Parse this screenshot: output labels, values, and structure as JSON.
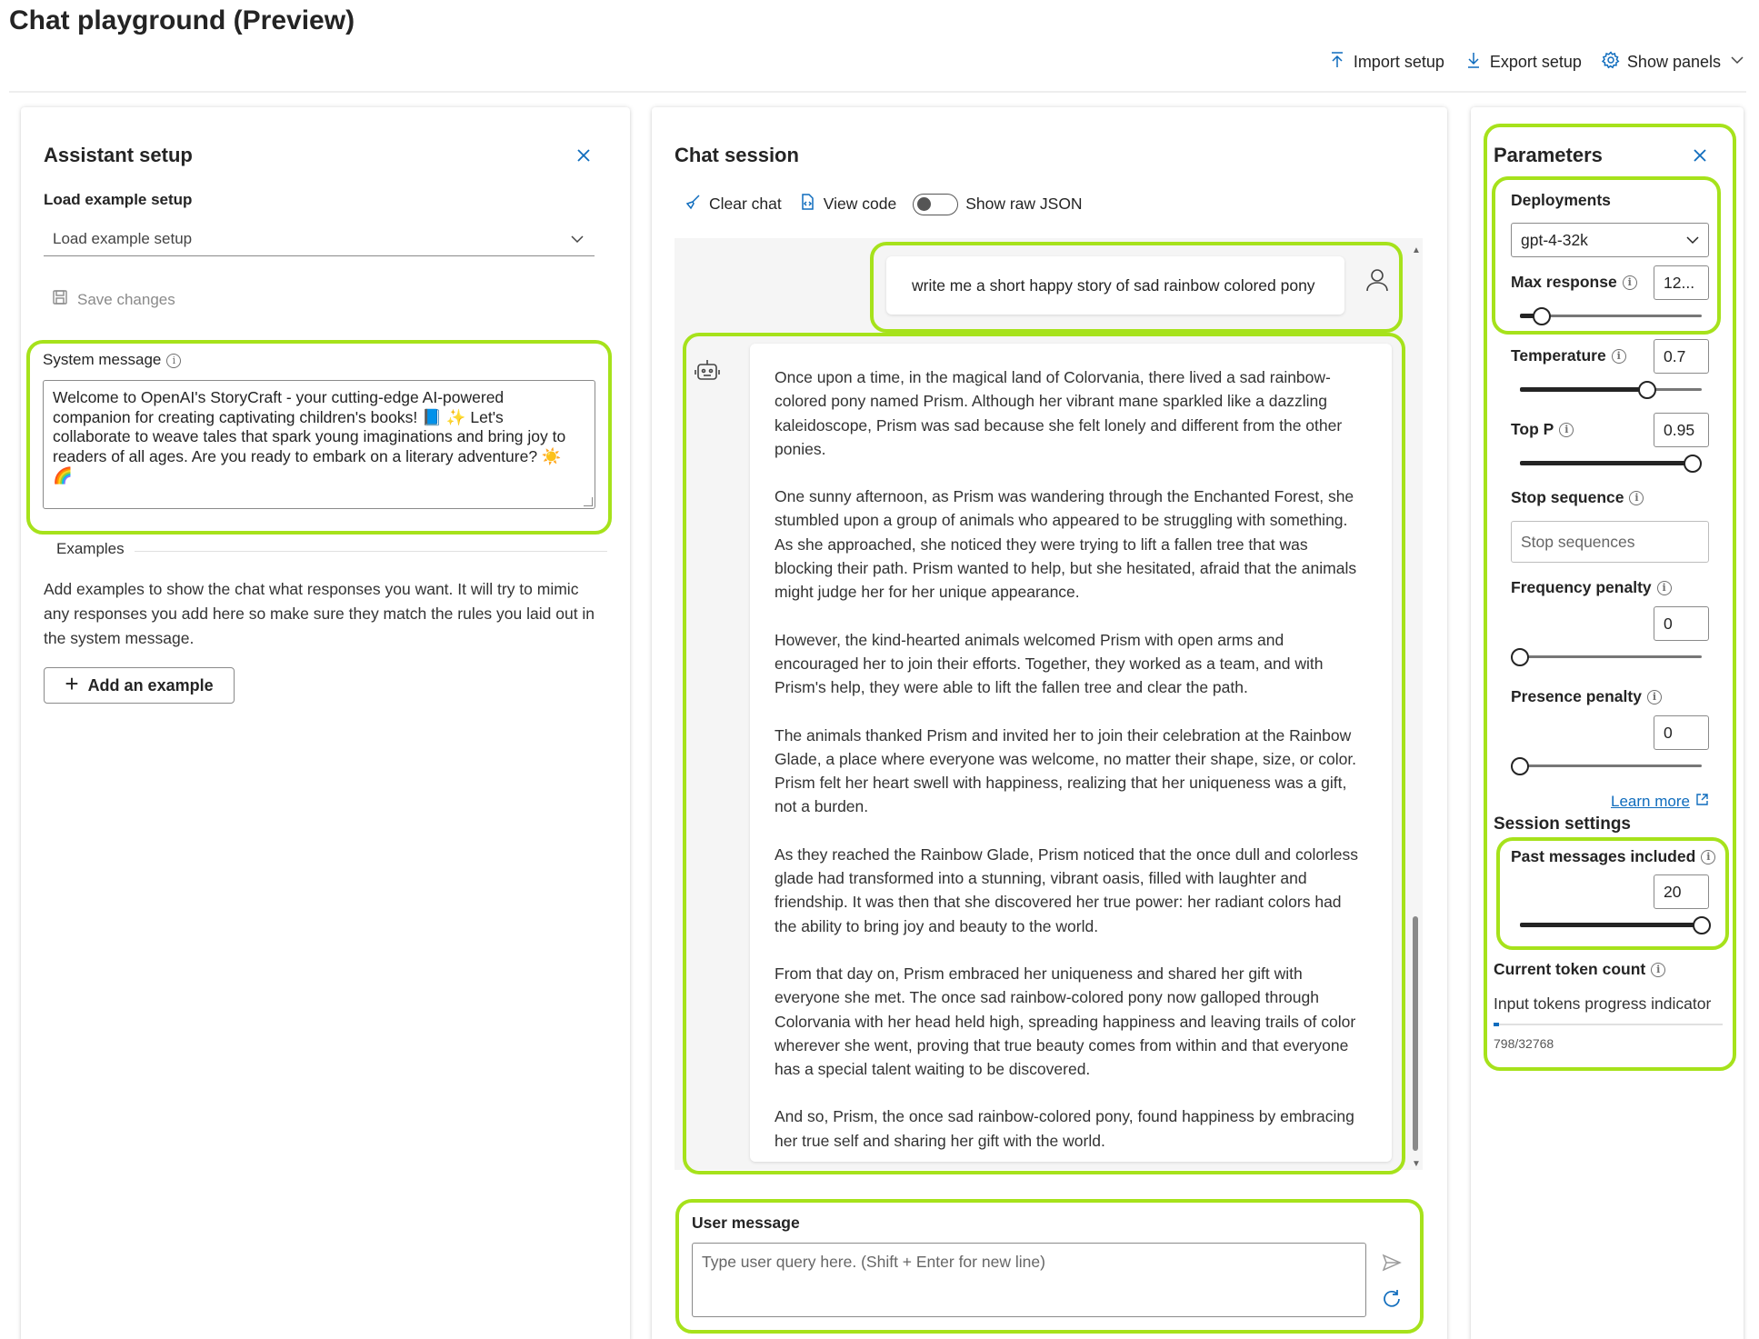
{
  "header": {
    "title": "Chat playground (Preview)",
    "import_label": "Import setup",
    "export_label": "Export setup",
    "panels_label": "Show panels"
  },
  "setup": {
    "title": "Assistant setup",
    "load_label": "Load example setup",
    "load_value": "Load example setup",
    "save_label": "Save changes",
    "system_label": "System message",
    "system_text": "Welcome to OpenAI's StoryCraft - your cutting-edge AI-powered companion for creating captivating children's books! 📘 ✨ Let's collaborate to weave tales that spark young imaginations and bring joy to readers of all ages. Are you ready to embark on a literary adventure? ☀️ 🌈",
    "examples_label": "Examples",
    "examples_desc": "Add examples to show the chat what responses you want. It will try to mimic any responses you add here so make sure they match the rules you laid out in the system message.",
    "add_example_label": "Add an example"
  },
  "chat": {
    "title": "Chat session",
    "clear_label": "Clear chat",
    "code_label": "View code",
    "json_label": "Show raw JSON",
    "user_message": "write me a short happy story of sad rainbow colored pony",
    "bot_paragraphs": [
      "Once upon a time, in the magical land of Colorvania, there lived a sad rainbow-colored pony named Prism. Although her vibrant mane sparkled like a dazzling kaleidoscope, Prism was sad because she felt lonely and different from the other ponies.",
      "One sunny afternoon, as Prism was wandering through the Enchanted Forest, she stumbled upon a group of animals who appeared to be struggling with something. As she approached, she noticed they were trying to lift a fallen tree that was blocking their path. Prism wanted to help, but she hesitated, afraid that the animals might judge her for her unique appearance.",
      "However, the kind-hearted animals welcomed Prism with open arms and encouraged her to join their efforts. Together, they worked as a team, and with Prism's help, they were able to lift the fallen tree and clear the path.",
      "The animals thanked Prism and invited her to join their celebration at the Rainbow Glade, a place where everyone was welcome, no matter their shape, size, or color. Prism felt her heart swell with happiness, realizing that her uniqueness was a gift, not a burden.",
      "As they reached the Rainbow Glade, Prism noticed that the once dull and colorless glade had transformed into a stunning, vibrant oasis, filled with laughter and friendship. It was then that she discovered her true power: her radiant colors had the ability to bring joy and beauty to the world.",
      "From that day on, Prism embraced her uniqueness and shared her gift with everyone she met. The once sad rainbow-colored pony now galloped through Colorvania with her head held high, spreading happiness and leaving trails of color wherever she went, proving that true beauty comes from within and that everyone has a special talent waiting to be discovered.",
      "And so, Prism, the once sad rainbow-colored pony, found happiness by embracing her true self and sharing her gift with the world."
    ],
    "input_label": "User message",
    "input_placeholder": "Type user query here. (Shift + Enter for new line)"
  },
  "params": {
    "title": "Parameters",
    "deployments_label": "Deployments",
    "deployment_value": "gpt-4-32k",
    "max_response_label": "Max response",
    "max_response_value": "12...",
    "max_response_level": 0.12,
    "temperature_label": "Temperature",
    "temperature_value": "0.7",
    "temperature_level": 0.7,
    "top_p_label": "Top P",
    "top_p_value": "0.95",
    "top_p_level": 0.95,
    "stop_label": "Stop sequence",
    "stop_placeholder": "Stop sequences",
    "freq_label": "Frequency penalty",
    "freq_value": "0",
    "freq_level": 0,
    "pres_label": "Presence penalty",
    "pres_value": "0",
    "pres_level": 0,
    "learn_more": "Learn more",
    "session_title": "Session settings",
    "past_label": "Past messages included",
    "past_value": "20",
    "past_level": 1.0,
    "token_title": "Current token count",
    "token_sub": "Input tokens progress indicator",
    "token_count": "798/32768",
    "token_fraction": 0.024
  },
  "colors": {
    "highlight": "#a6e21b",
    "accent": "#0f6cbd"
  }
}
